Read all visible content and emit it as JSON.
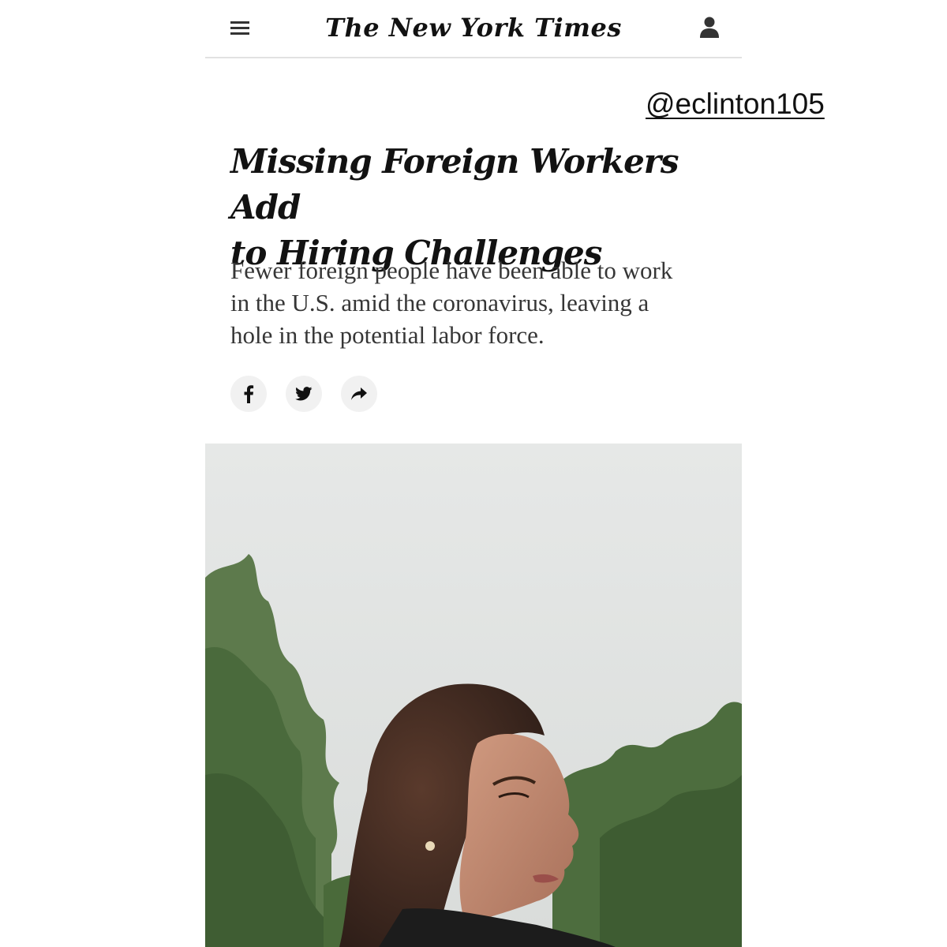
{
  "header": {
    "masthead": "The New York Times",
    "menu_icon": "hamburger-menu-icon",
    "account_icon": "user-account-icon"
  },
  "watermark": {
    "handle": "@eclinton105"
  },
  "article": {
    "headline_line1": "Missing Foreign Workers Add",
    "headline_line2": "to Hiring Challenges",
    "summary_line1": "Fewer foreign people have been able to work",
    "summary_line2": "in the U.S. amid the coronavirus, leaving a",
    "summary_line3": "hole in the potential labor force."
  },
  "share": {
    "buttons": [
      {
        "icon": "facebook-icon"
      },
      {
        "icon": "twitter-icon"
      },
      {
        "icon": "share-arrow-icon"
      }
    ]
  },
  "image": {
    "subject": "woman-portrait-photo"
  },
  "colors": {
    "text": "#121212",
    "summary": "#363636",
    "divider": "#e2e2e2",
    "button_bg": "#f1f1f1"
  }
}
